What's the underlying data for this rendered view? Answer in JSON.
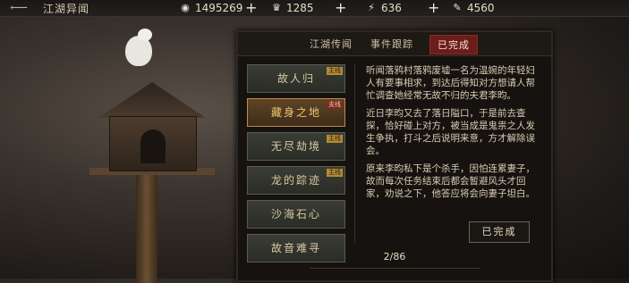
{
  "header": {
    "title": "江湖异闻",
    "back_icon": "back-arrow-icon"
  },
  "resources": [
    {
      "icon": "coin-icon",
      "value": "1495269"
    },
    {
      "icon": "silver-ingot-icon",
      "value": "1285"
    },
    {
      "icon": "lightning-icon",
      "value": "636"
    },
    {
      "icon": "ticket-icon",
      "value": "4560"
    }
  ],
  "tabs": [
    {
      "label": "江湖传闻",
      "active": false
    },
    {
      "label": "事件跟踪",
      "active": false
    },
    {
      "label": "已完成",
      "active": true
    }
  ],
  "quests": [
    {
      "label": "故人归",
      "badge": "主线",
      "selected": false
    },
    {
      "label": "藏身之地",
      "badge": "支线",
      "selected": true
    },
    {
      "label": "无尽劫境",
      "badge": "主线",
      "selected": false
    },
    {
      "label": "龙的踪迹",
      "badge": "主线",
      "selected": false
    },
    {
      "label": "沙海石心",
      "badge": "",
      "selected": false
    },
    {
      "label": "故音难寻",
      "badge": "",
      "selected": false
    }
  ],
  "detail": {
    "paragraphs": [
      "听闻落鸦村落鸦废墟一名为温婉的年轻妇人有要事相求，到达后得知对方想请人帮忙调查她经常无故不归的夫君李昀。",
      "近日李昀又去了落日隘口，于是前去查探，恰好碰上对方，被当成是鬼祟之人发生争执，打斗之后说明来意，方才解除误会。",
      "原来李昀私下是个杀手，因怕连累妻子，故而每次任务结束后都会暂避风头才回家，劝说之下，他答应将会向妻子坦白。"
    ],
    "done_label": "已完成"
  },
  "pager": {
    "text": "2/86"
  }
}
